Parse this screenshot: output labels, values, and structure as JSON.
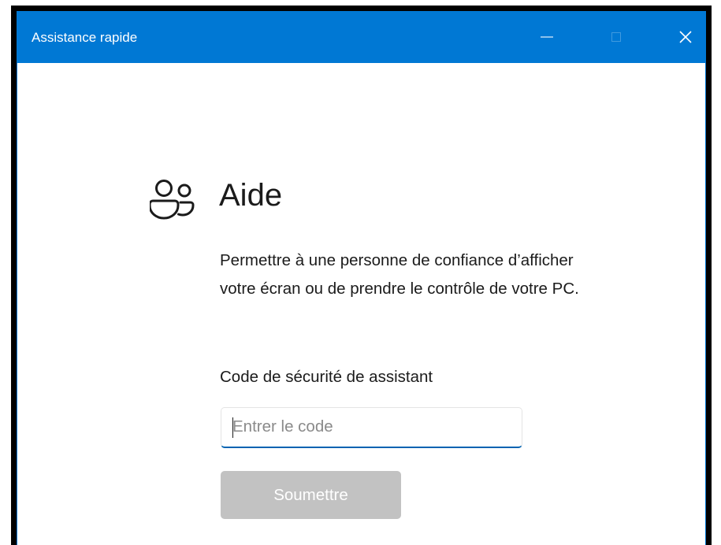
{
  "window": {
    "title": "Assistance rapide",
    "title_bar_color": "#0078d4",
    "controls": {
      "minimize_icon": "minimize-icon",
      "maximize_icon": "maximize-icon",
      "close_icon": "close-icon"
    }
  },
  "main": {
    "heading_icon": "people-icon",
    "heading": "Aide",
    "description": "Permettre à une personne de confiance d’afficher votre écran ou de prendre le contrôle de votre PC.",
    "code_label": "Code de sécurité de assistant",
    "code_input": {
      "value": "",
      "placeholder": "Entrer le code"
    },
    "submit_label": "Soumettre",
    "submit_color": "#c2c2c2"
  }
}
